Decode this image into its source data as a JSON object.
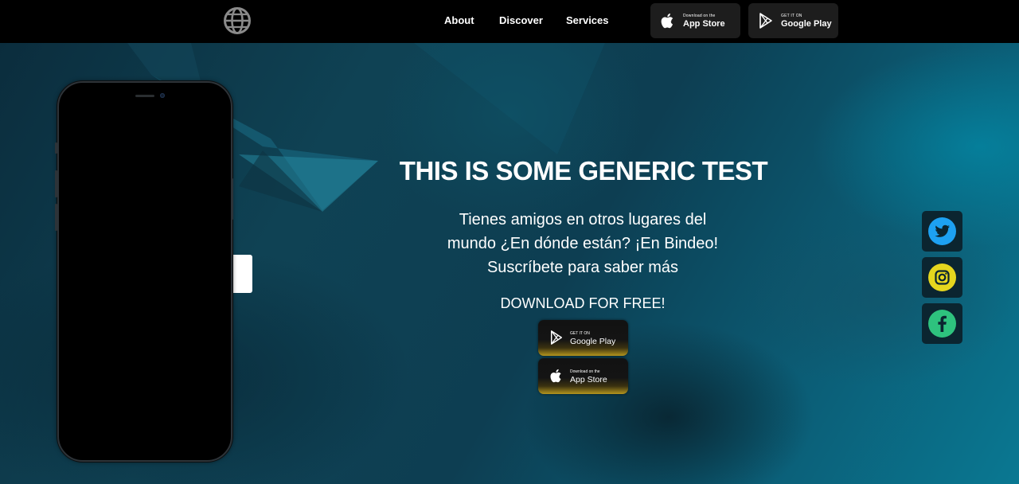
{
  "nav": {
    "links": [
      "About",
      "Discover",
      "Services"
    ],
    "app_store": {
      "small": "Download on the",
      "big": "App Store"
    },
    "google_play": {
      "small": "GET IT ON",
      "big": "Google Play"
    }
  },
  "hero": {
    "title": "THIS IS SOME GENERIC TEST",
    "subtitle_lines": [
      "Tienes amigos en otros lugares del",
      "mundo ¿En dónde están? ¡En Bindeo!",
      "Suscríbete para saber más"
    ],
    "download_label": "DOWNLOAD FOR FREE!",
    "google_play": {
      "small": "GET IT ON",
      "big": "Google Play"
    },
    "app_store": {
      "small": "Download on the",
      "big": "App Store"
    }
  },
  "social": [
    {
      "icon": "twitter-icon",
      "color": "#1da1f2"
    },
    {
      "icon": "instagram-icon",
      "color": "#e5d61e"
    },
    {
      "icon": "facebook-icon",
      "color": "#2ec27e"
    }
  ],
  "colors": {
    "accent_gold": "#b3951e",
    "nav_bg": "#000000"
  }
}
